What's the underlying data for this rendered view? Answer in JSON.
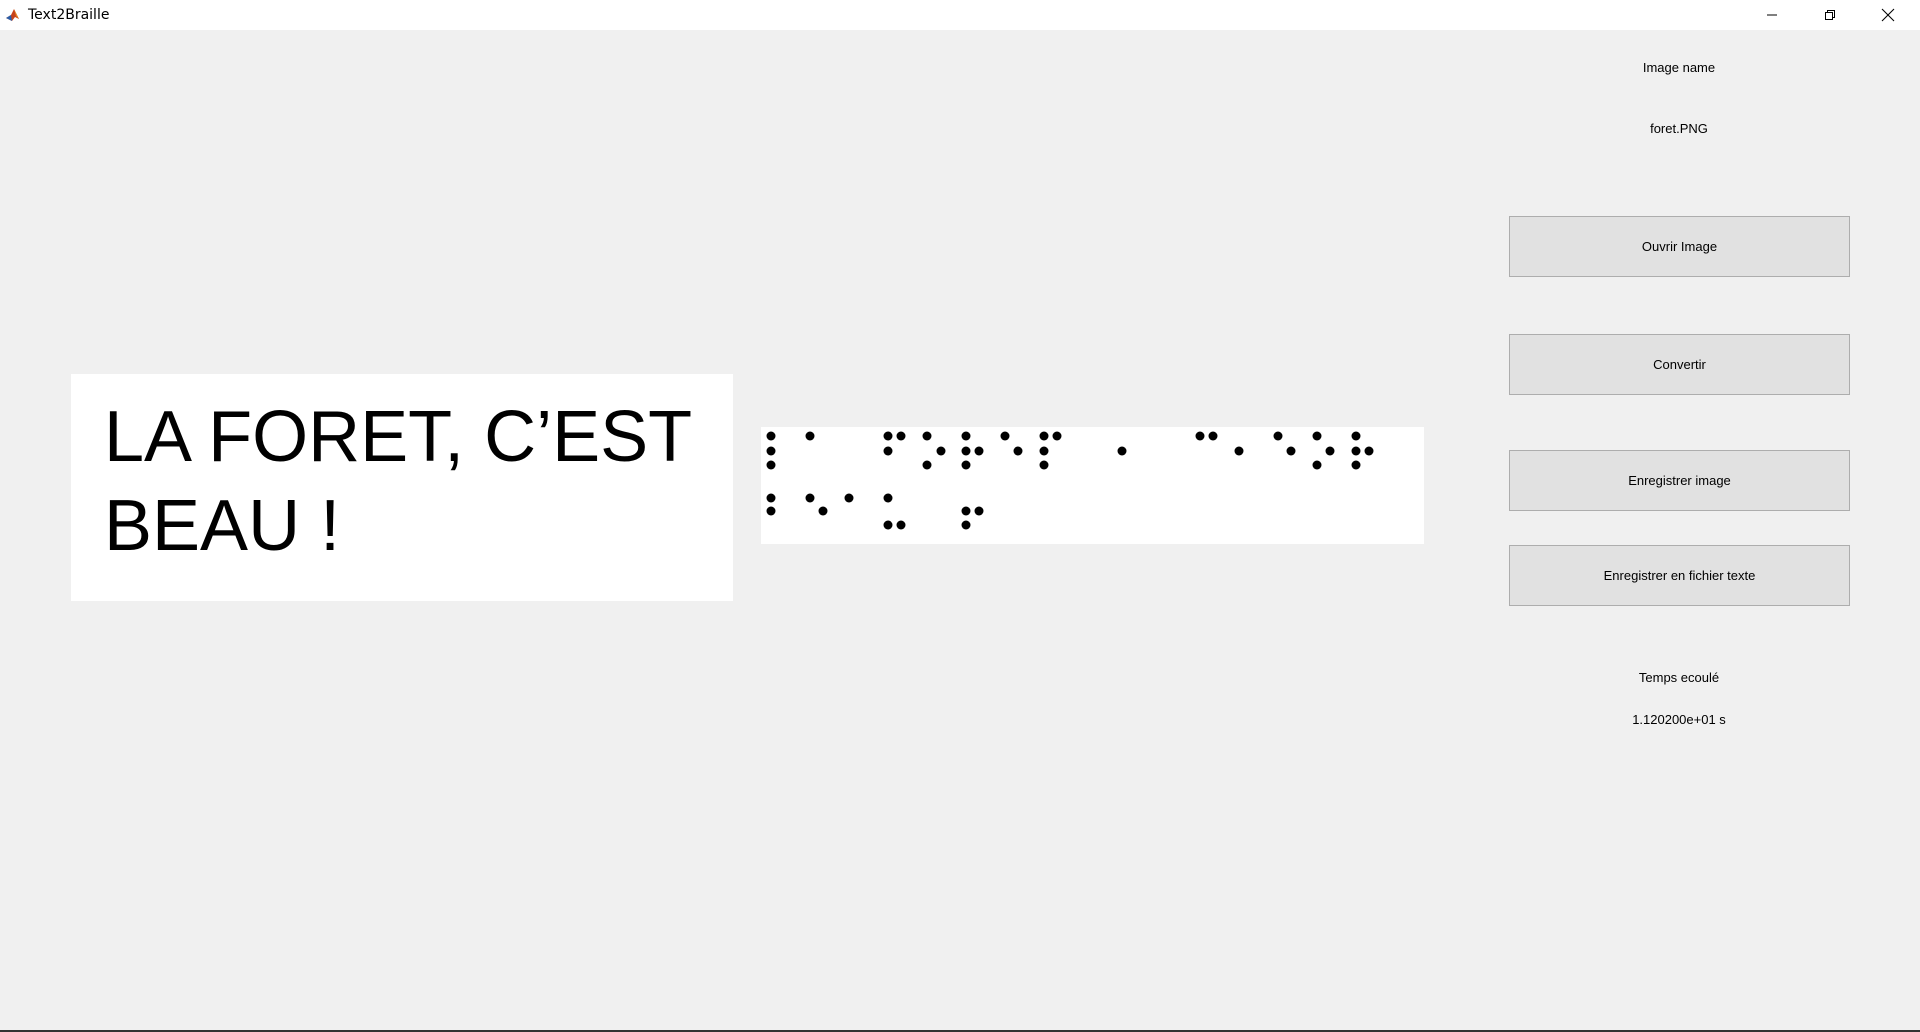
{
  "window": {
    "title": "Text2Braille",
    "icon": "matlab-icon",
    "controls": [
      "minimize-icon",
      "restore-icon",
      "close-icon"
    ]
  },
  "source_image": {
    "line1": "LA FORET, C’EST",
    "line2": "BEAU !"
  },
  "braille_image": {
    "description_icon": "braille-dots"
  },
  "panel": {
    "image_name_label": "Image name",
    "image_name_value": "foret.PNG",
    "open_button": "Ouvrir Image",
    "convert_button": "Convertir",
    "save_image_button": "Enregistrer image",
    "save_text_button": "Enregistrer en fichier texte",
    "elapsed_label": "Temps ecoulé",
    "elapsed_value": "1.120200e+01 s"
  },
  "colors": {
    "background": "#f0f0f0",
    "button_face": "#e1e1e1",
    "button_border": "#adadad"
  }
}
